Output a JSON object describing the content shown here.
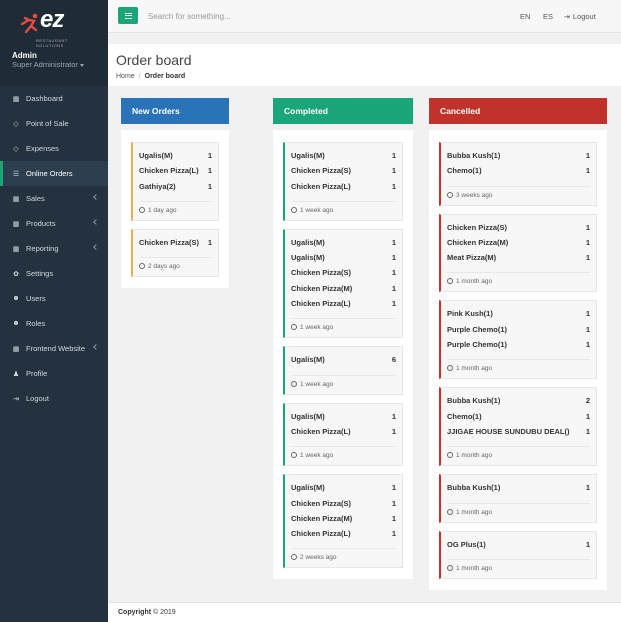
{
  "brand": {
    "logo_text": "ez",
    "tagline": "RESTAURANT SOLUTIONS",
    "admin_name": "Admin",
    "admin_role": "Super Administrator"
  },
  "sidebar": {
    "items": [
      {
        "label": "Dashboard",
        "icon": "dashboard-icon"
      },
      {
        "label": "Point of Sale",
        "icon": "diamond-icon"
      },
      {
        "label": "Expenses",
        "icon": "diamond-icon"
      },
      {
        "label": "Online Orders",
        "icon": "list-icon",
        "active": true
      },
      {
        "label": "Sales",
        "icon": "grid-icon",
        "has_children": true
      },
      {
        "label": "Products",
        "icon": "grid-icon",
        "has_children": true
      },
      {
        "label": "Reporting",
        "icon": "grid-icon",
        "has_children": true
      },
      {
        "label": "Settings",
        "icon": "gear-icon"
      },
      {
        "label": "Users",
        "icon": "users-icon"
      },
      {
        "label": "Roles",
        "icon": "users-icon"
      },
      {
        "label": "Frontend Website",
        "icon": "grid-icon",
        "has_children": true
      },
      {
        "label": "Profile",
        "icon": "user-icon"
      },
      {
        "label": "Logout",
        "icon": "logout-icon"
      }
    ]
  },
  "topbar": {
    "search_placeholder": "Search for something...",
    "lang_en": "EN",
    "lang_es": "ES",
    "logout": "Logout"
  },
  "page": {
    "title": "Order board",
    "breadcrumb_home": "Home",
    "breadcrumb_current": "Order board"
  },
  "colors": {
    "accent": "#1aa57b",
    "new": "#2a73b8",
    "completed": "#1aa57b",
    "cancelled": "#c0332a",
    "new_border": "#f0ad4e",
    "completed_border": "#1aa57b",
    "cancelled_border": "#c9302c"
  },
  "columns": {
    "new": {
      "title": "New Orders",
      "orders": [
        {
          "items": [
            [
              "Ugalis(M)",
              "1"
            ],
            [
              "Chicken Pizza(L)",
              "1"
            ],
            [
              "Gathiya(2)",
              "1"
            ]
          ],
          "time": "1 day ago"
        },
        {
          "items": [
            [
              "Chicken Pizza(S)",
              "1"
            ]
          ],
          "time": "2 days ago"
        }
      ]
    },
    "completed": {
      "title": "Completed",
      "orders": [
        {
          "items": [
            [
              "Ugalis(M)",
              "1"
            ],
            [
              "Chicken Pizza(S)",
              "1"
            ],
            [
              "Chicken Pizza(L)",
              "1"
            ]
          ],
          "time": "1 week ago"
        },
        {
          "items": [
            [
              "Ugalis(M)",
              "1"
            ],
            [
              "Ugalis(M)",
              "1"
            ],
            [
              "Chicken Pizza(S)",
              "1"
            ],
            [
              "Chicken Pizza(M)",
              "1"
            ],
            [
              "Chicken Pizza(L)",
              "1"
            ]
          ],
          "time": "1 week ago"
        },
        {
          "items": [
            [
              "Ugalis(M)",
              "6"
            ]
          ],
          "time": "1 week ago"
        },
        {
          "items": [
            [
              "Ugalis(M)",
              "1"
            ],
            [
              "Chicken Pizza(L)",
              "1"
            ]
          ],
          "time": "1 week ago"
        },
        {
          "items": [
            [
              "Ugalis(M)",
              "1"
            ],
            [
              "Chicken Pizza(S)",
              "1"
            ],
            [
              "Chicken Pizza(M)",
              "1"
            ],
            [
              "Chicken Pizza(L)",
              "1"
            ]
          ],
          "time": "2 weeks ago"
        }
      ]
    },
    "cancelled": {
      "title": "Cancelled",
      "orders": [
        {
          "items": [
            [
              "Bubba Kush(1)",
              "1"
            ],
            [
              "Chemo(1)",
              "1"
            ]
          ],
          "time": "3 weeks ago"
        },
        {
          "items": [
            [
              "Chicken Pizza(S)",
              "1"
            ],
            [
              "Chicken Pizza(M)",
              "1"
            ],
            [
              "Meat Pizza(M)",
              "1"
            ]
          ],
          "time": "1 month ago"
        },
        {
          "items": [
            [
              "Pink Kush(1)",
              "1"
            ],
            [
              "Purple Chemo(1)",
              "1"
            ],
            [
              "Purple Chemo(1)",
              "1"
            ]
          ],
          "time": "1 month ago"
        },
        {
          "items": [
            [
              "Bubba Kush(1)",
              "2"
            ],
            [
              "Chemo(1)",
              "1"
            ],
            [
              "JJIGAE HOUSE SUNDUBU DEAL()",
              "1"
            ]
          ],
          "time": "1 month ago"
        },
        {
          "items": [
            [
              "Bubba Kush(1)",
              "1"
            ]
          ],
          "time": "1 month ago"
        },
        {
          "items": [
            [
              "OG Plus(1)",
              "1"
            ]
          ],
          "time": "1 month ago"
        }
      ]
    }
  },
  "footer": {
    "copyright_label": "Copyright",
    "copyright_text": "© 2019"
  }
}
